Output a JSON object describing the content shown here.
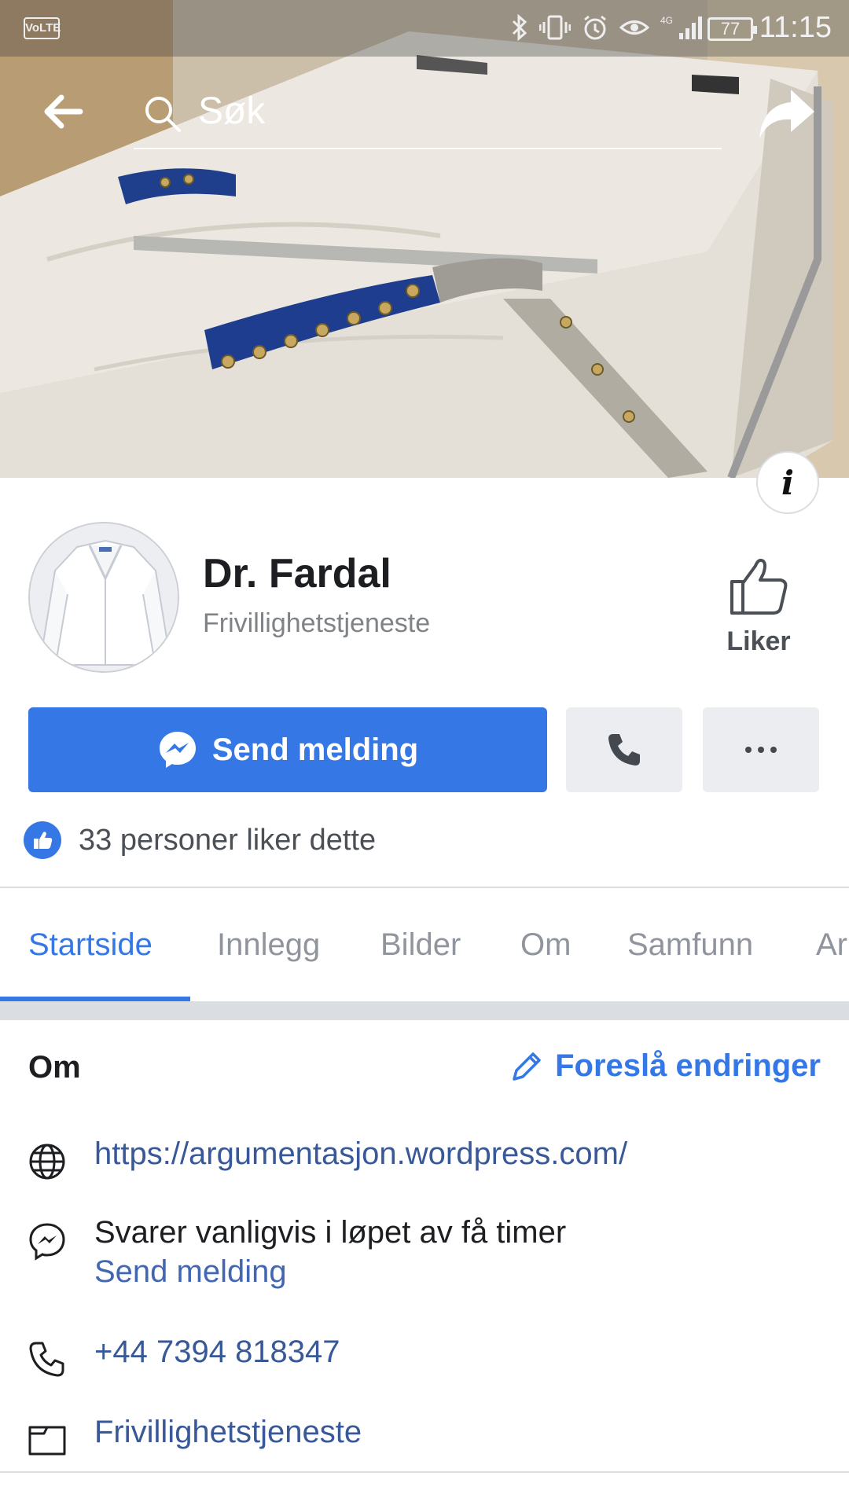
{
  "status_bar": {
    "network": "VoLTE",
    "signal_label": "4G",
    "battery": "77",
    "time": "11:15"
  },
  "top_bar": {
    "search_placeholder": "Søk"
  },
  "page": {
    "name": "Dr. Fardal",
    "category": "Frivillighetstjeneste",
    "like_button_label": "Liker"
  },
  "actions": {
    "message_label": "Send melding"
  },
  "likes": {
    "text": "33 personer liker dette"
  },
  "tabs": [
    {
      "label": "Startside",
      "active": true
    },
    {
      "label": "Innlegg",
      "active": false
    },
    {
      "label": "Bilder",
      "active": false
    },
    {
      "label": "Om",
      "active": false
    },
    {
      "label": "Samfunn",
      "active": false
    },
    {
      "label": "Ar",
      "active": false
    }
  ],
  "about": {
    "title": "Om",
    "suggest_label": "Foreslå endringer",
    "website": "https://argumentasjon.wordpress.com/",
    "response_time": "Svarer vanligvis i løpet av få timer",
    "send_message_link": "Send melding",
    "phone": "+44 7394 818347",
    "category": "Frivillighetstjeneste"
  },
  "colors": {
    "accent": "#3578e5",
    "link": "#385898",
    "muted": "#90949c"
  }
}
